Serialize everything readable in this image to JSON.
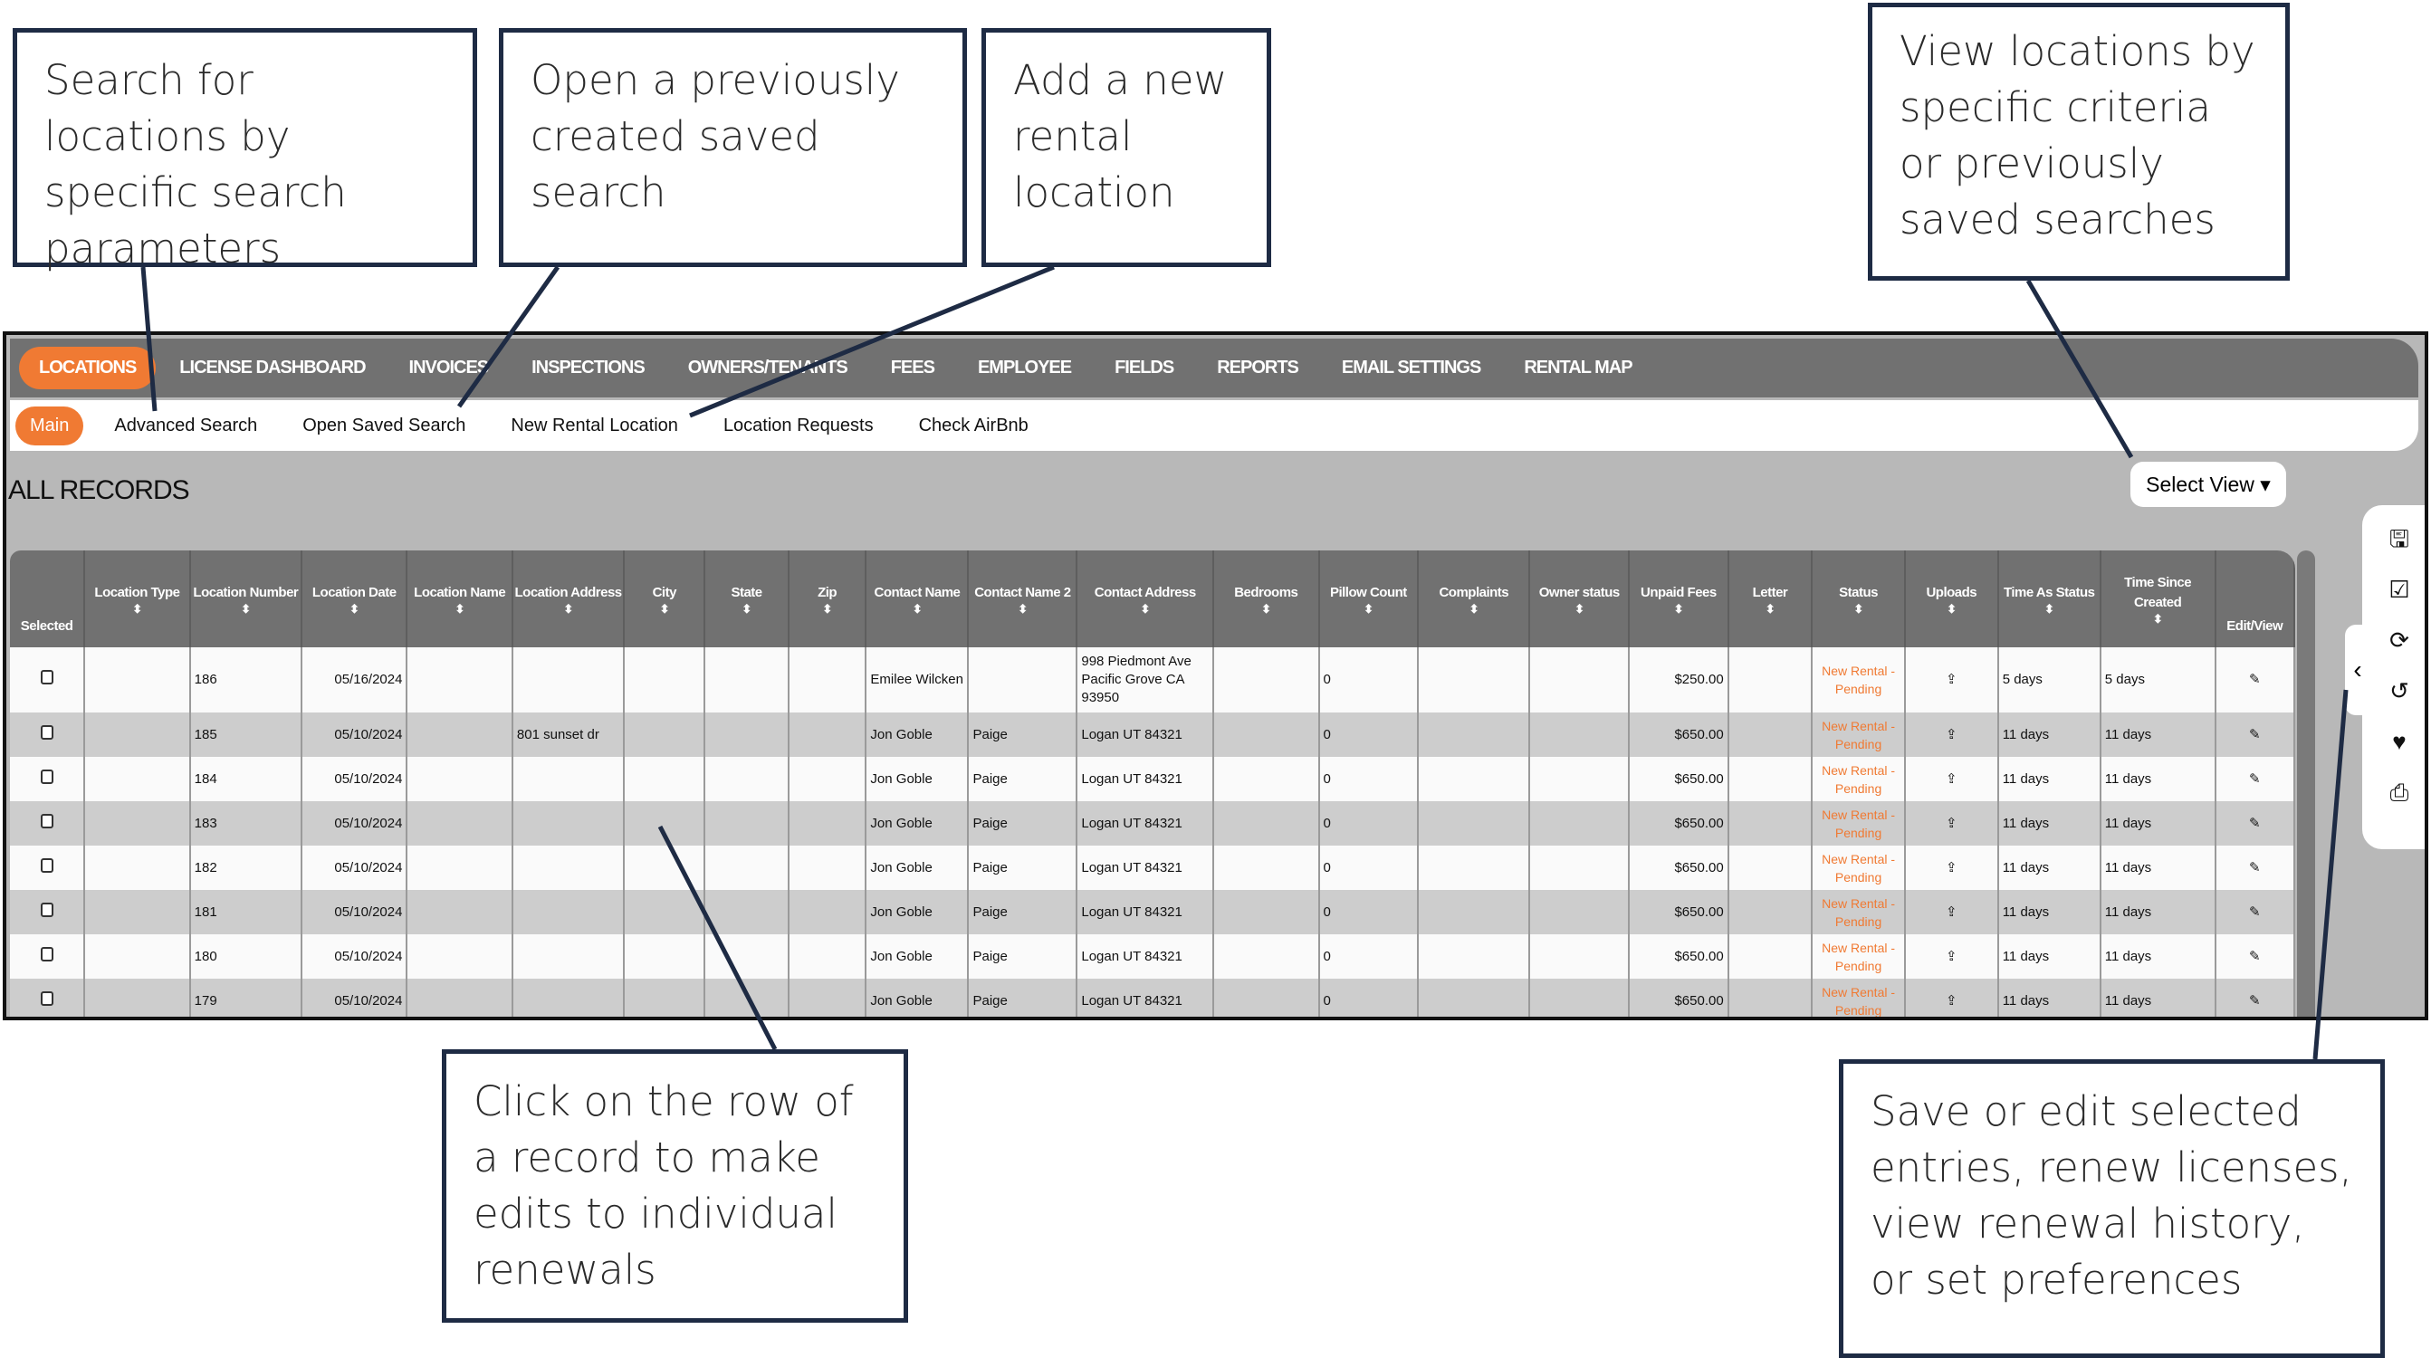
{
  "callouts": {
    "search": "Search for locations by specific search parameters",
    "saved": "Open a previously created saved search",
    "add": "Add a new rental location",
    "view": "View locations by specific criteria or previously saved searches",
    "row": "Click on the row of a record to make edits to individual renewals",
    "tools": "Save or edit selected entries, renew licenses, view renewal history, or set preferences"
  },
  "nav": [
    "LOCATIONS",
    "LICENSE DASHBOARD",
    "INVOICES",
    "INSPECTIONS",
    "OWNERS/TENANTS",
    "FEES",
    "EMPLOYEE",
    "FIELDS",
    "REPORTS",
    "EMAIL SETTINGS",
    "RENTAL MAP"
  ],
  "subnav": [
    "Main",
    "Advanced Search",
    "Open Saved Search",
    "New Rental Location",
    "Location Requests",
    "Check AirBnb"
  ],
  "title": "ALL RECORDS",
  "select_view": "Select View ▾",
  "colors": {
    "accent": "#f07a33",
    "nav": "#717171",
    "background": "#b8b8b8"
  },
  "columns": [
    "Selected",
    "Location Type",
    "Location Number",
    "Location Date",
    "Location Name",
    "Location Address",
    "City",
    "State",
    "Zip",
    "Contact Name",
    "Contact Name 2",
    "Contact Address",
    "Bedrooms",
    "Pillow Count",
    "Complaints",
    "Owner status",
    "Unpaid Fees",
    "Letter",
    "Status",
    "Uploads",
    "Time As Status",
    "Time Since Created",
    "Edit/View"
  ],
  "rows": [
    {
      "number": "186",
      "date": "05/16/2024",
      "address": "",
      "contact": "Emilee Wilcken",
      "contact2": "",
      "contact_address": "998 Piedmont Ave Pacific Grove CA 93950",
      "pillow": "0",
      "fees": "$250.00",
      "status": "New Rental - Pending",
      "time_status": "5 days",
      "time_created": "5 days"
    },
    {
      "number": "185",
      "date": "05/10/2024",
      "address": "801 sunset dr",
      "contact": "Jon Goble",
      "contact2": "Paige",
      "contact_address": "Logan UT 84321",
      "pillow": "0",
      "fees": "$650.00",
      "status": "New Rental - Pending",
      "time_status": "11 days",
      "time_created": "11 days"
    },
    {
      "number": "184",
      "date": "05/10/2024",
      "address": "",
      "contact": "Jon Goble",
      "contact2": "Paige",
      "contact_address": "Logan UT 84321",
      "pillow": "0",
      "fees": "$650.00",
      "status": "New Rental - Pending",
      "time_status": "11 days",
      "time_created": "11 days"
    },
    {
      "number": "183",
      "date": "05/10/2024",
      "address": "",
      "contact": "Jon Goble",
      "contact2": "Paige",
      "contact_address": "Logan UT 84321",
      "pillow": "0",
      "fees": "$650.00",
      "status": "New Rental - Pending",
      "time_status": "11 days",
      "time_created": "11 days"
    },
    {
      "number": "182",
      "date": "05/10/2024",
      "address": "",
      "contact": "Jon Goble",
      "contact2": "Paige",
      "contact_address": "Logan UT 84321",
      "pillow": "0",
      "fees": "$650.00",
      "status": "New Rental - Pending",
      "time_status": "11 days",
      "time_created": "11 days"
    },
    {
      "number": "181",
      "date": "05/10/2024",
      "address": "",
      "contact": "Jon Goble",
      "contact2": "Paige",
      "contact_address": "Logan UT 84321",
      "pillow": "0",
      "fees": "$650.00",
      "status": "New Rental - Pending",
      "time_status": "11 days",
      "time_created": "11 days"
    },
    {
      "number": "180",
      "date": "05/10/2024",
      "address": "",
      "contact": "Jon Goble",
      "contact2": "Paige",
      "contact_address": "Logan UT 84321",
      "pillow": "0",
      "fees": "$650.00",
      "status": "New Rental - Pending",
      "time_status": "11 days",
      "time_created": "11 days"
    },
    {
      "number": "179",
      "date": "05/10/2024",
      "address": "",
      "contact": "Jon Goble",
      "contact2": "Paige",
      "contact_address": "Logan UT 84321",
      "pillow": "0",
      "fees": "$650.00",
      "status": "New Rental - Pending",
      "time_status": "11 days",
      "time_created": "11 days"
    }
  ],
  "side_tools": [
    {
      "icon": "save-icon",
      "glyph": "🖫"
    },
    {
      "icon": "checkbox-icon",
      "glyph": "☑"
    },
    {
      "icon": "refresh-icon",
      "glyph": "⟳"
    },
    {
      "icon": "history-icon",
      "glyph": "↺"
    },
    {
      "icon": "heart-icon",
      "glyph": "♥"
    },
    {
      "icon": "print-icon",
      "glyph": "⎙"
    }
  ],
  "icons": {
    "sort": "⬍",
    "upload": "⇪",
    "edit": "✎",
    "collapse": "‹"
  }
}
